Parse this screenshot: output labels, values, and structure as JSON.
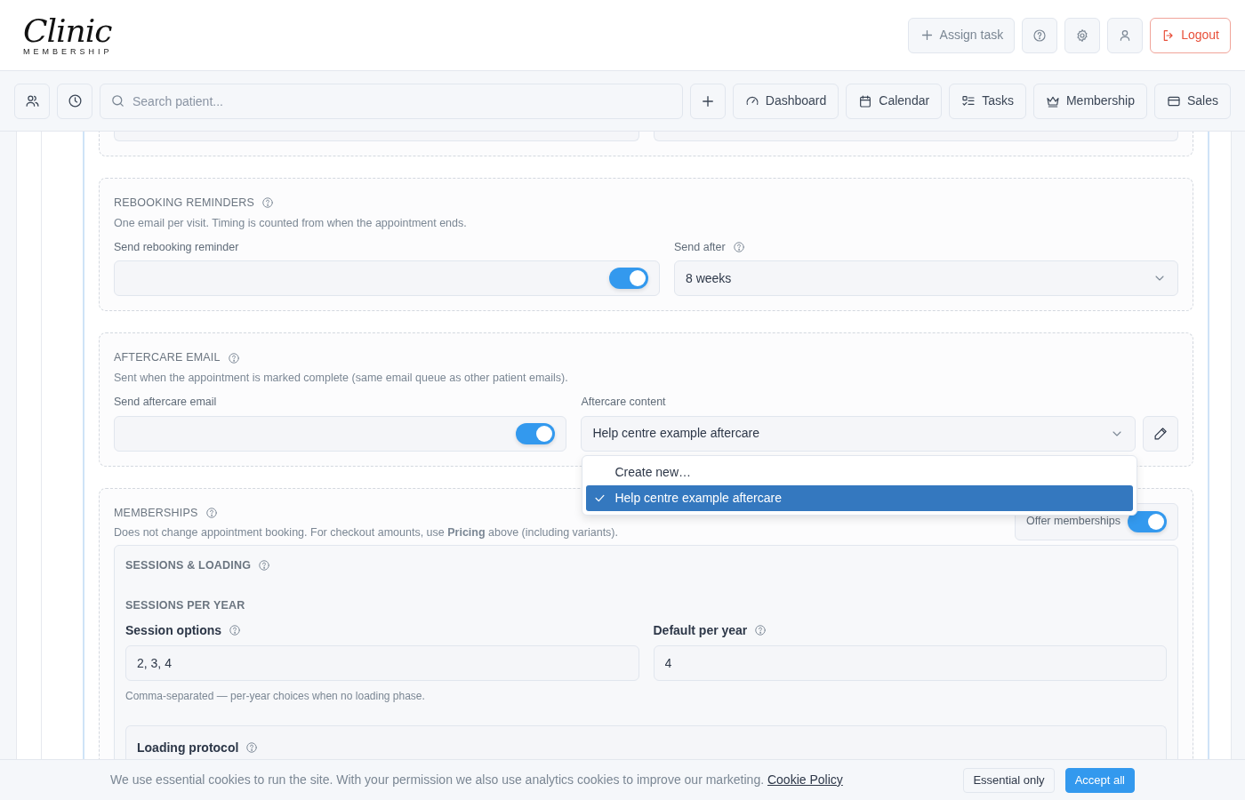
{
  "logo": {
    "script": "Clinic",
    "subtitle": "MEMBERSHIP"
  },
  "header_actions": [
    {
      "kind": "assign",
      "label": "Assign task"
    },
    {
      "kind": "help"
    },
    {
      "kind": "settings"
    },
    {
      "kind": "user"
    },
    {
      "kind": "logout",
      "label": "Logout"
    }
  ],
  "toolbar": {
    "quick_buttons": [
      {
        "kind": "patients"
      },
      {
        "kind": "history"
      }
    ],
    "search": {
      "placeholder": "Search patient..."
    },
    "nav": [
      {
        "kind": "add"
      },
      {
        "kind": "dashboard",
        "label": "Dashboard"
      },
      {
        "kind": "calendar",
        "label": "Calendar"
      },
      {
        "kind": "tasks",
        "label": "Tasks"
      },
      {
        "kind": "membership",
        "label": "Membership"
      },
      {
        "kind": "sales",
        "label": "Sales"
      }
    ]
  },
  "sections": [
    {
      "kind": "settings",
      "title": "REBOOKING REMINDERS",
      "help": true,
      "description": "One email per visit. Timing is counted from when the appointment ends.",
      "fields": [
        {
          "kind": "toggle",
          "label": "Send rebooking reminder",
          "on": true
        },
        {
          "kind": "select",
          "label": "Send after",
          "help": true,
          "value": "8 weeks"
        }
      ]
    },
    {
      "kind": "settings",
      "title": "AFTERCARE EMAIL",
      "help": true,
      "description": "Sent when the appointment is marked complete (same email queue as other patient emails).",
      "fields": [
        {
          "kind": "toggle",
          "label": "Send aftercare email",
          "on": true
        },
        {
          "kind": "select",
          "label": "Aftercare content",
          "value": "Help centre example aftercare",
          "editable": true,
          "options": [
            {
              "label": "Create new…",
              "selected": false
            },
            {
              "label": "Help centre example aftercare",
              "selected": true
            }
          ]
        }
      ]
    },
    {
      "kind": "memberships",
      "title": "MEMBERSHIPS",
      "help": true,
      "description": "Does not change appointment booking. For checkout amounts, use **Pricing** above (including variants).",
      "switch": {
        "label": "Offer memberships",
        "on": true
      },
      "panel": {
        "title": "SESSIONS & LOADING",
        "help": true,
        "subheading": "SESSIONS PER YEAR",
        "fields": [
          {
            "label": "Session options",
            "help": true,
            "value": "2, 3, 4"
          },
          {
            "label": "Default per year",
            "help": true,
            "value": "4"
          }
        ],
        "hint": "Comma-separated — per-year choices when no loading phase.",
        "subpanel": {
          "title": "Loading protocol",
          "help": true
        }
      }
    }
  ],
  "cookie_bar": {
    "text": "We use essential cookies to run the site. With your permission we also use analytics cookies to improve our marketing.",
    "link": "Cookie Policy",
    "buttons": [
      {
        "kind": "secondary",
        "label": "Essential only"
      },
      {
        "kind": "primary",
        "label": "Accept all"
      }
    ]
  }
}
